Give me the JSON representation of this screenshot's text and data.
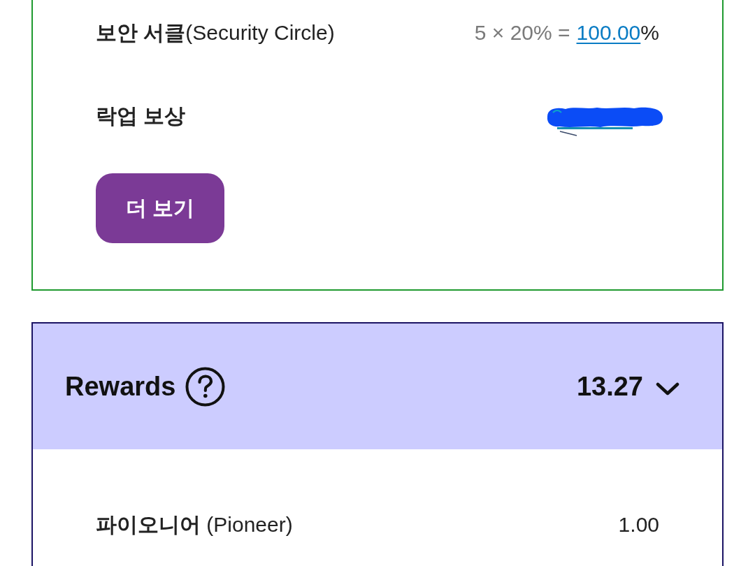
{
  "security_card": {
    "rows": [
      {
        "kind": "formula",
        "label": "**보안 서클**(Security Circle)",
        "formula": "5 × 20% =",
        "link": "100.00",
        "suffix": "%"
      },
      {
        "kind": "redacted",
        "label": "락업 보상"
      }
    ],
    "button": "더 보기"
  },
  "rewards": {
    "title": "Rewards",
    "total": "13.27",
    "expanded": true,
    "items": [
      {
        "label": "**파이오니어** (Pioneer)",
        "value": "1.00"
      }
    ]
  }
}
